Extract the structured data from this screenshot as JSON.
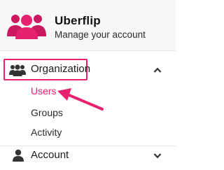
{
  "header": {
    "brand_name": "Uberflip",
    "subtitle": "Manage your account",
    "logo_icon": "users-group-icon",
    "accent_color": "#e8216e"
  },
  "nav": {
    "organization": {
      "label": "Organization",
      "icon": "users-icon",
      "expanded": true,
      "items": [
        {
          "label": "Users",
          "selected": true
        },
        {
          "label": "Groups",
          "selected": false
        },
        {
          "label": "Activity",
          "selected": false
        }
      ]
    },
    "account": {
      "label": "Account",
      "icon": "user-icon",
      "expanded": false
    }
  },
  "annotation": {
    "highlight_color": "#e8216e",
    "arrow_icon": "pointer-arrow-icon"
  }
}
